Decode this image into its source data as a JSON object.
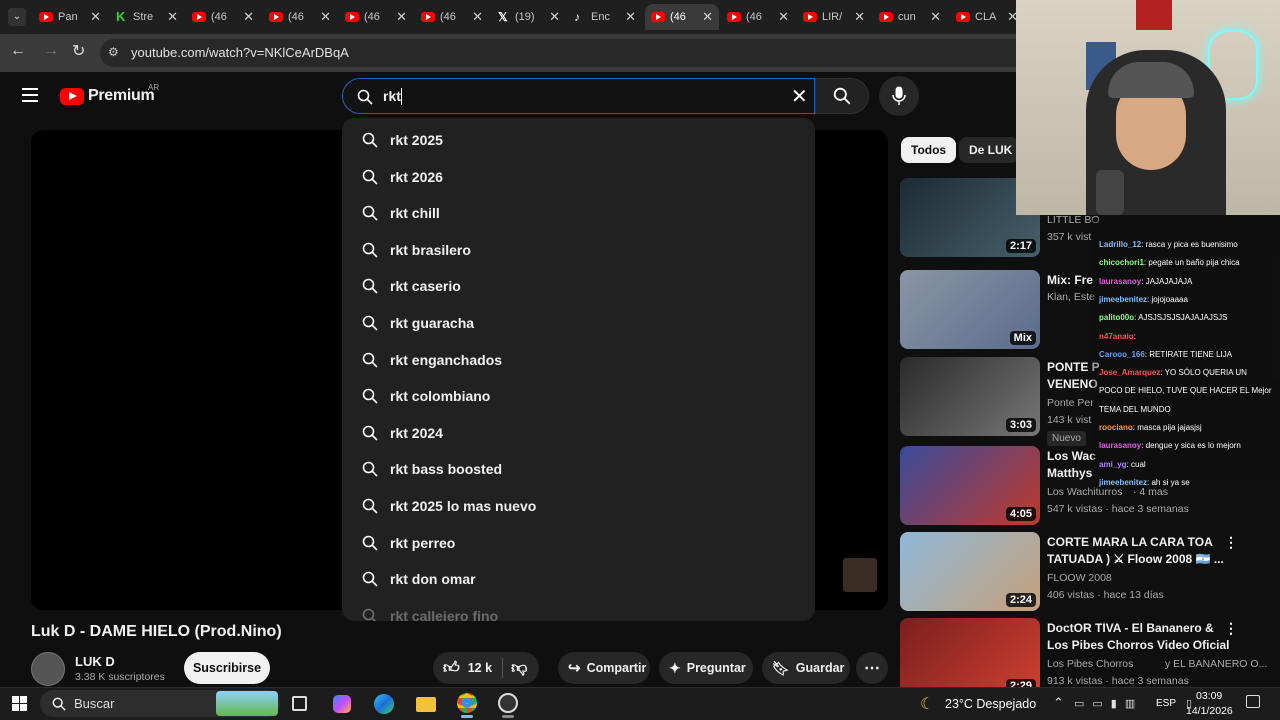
{
  "browser": {
    "tabs": [
      {
        "title": "Pan",
        "favicon": "youtube"
      },
      {
        "title": "Stre",
        "favicon": "kick"
      },
      {
        "title": "(46",
        "favicon": "youtube"
      },
      {
        "title": "(46",
        "favicon": "youtube"
      },
      {
        "title": "(46",
        "favicon": "youtube"
      },
      {
        "title": "(46",
        "favicon": "youtube"
      },
      {
        "title": "(19)",
        "favicon": "x"
      },
      {
        "title": "Enc",
        "favicon": "tiktok"
      },
      {
        "title": "(46",
        "favicon": "youtube",
        "active": true
      },
      {
        "title": "(46",
        "favicon": "youtube"
      },
      {
        "title": "LIR/",
        "favicon": "youtube"
      },
      {
        "title": "cun",
        "favicon": "youtube"
      },
      {
        "title": "CLA",
        "favicon": "youtube"
      }
    ],
    "url": "youtube.com/watch?v=NKlCeArDBqA"
  },
  "header": {
    "logo_text": "Premium",
    "country": "AR",
    "search_value": "rkt"
  },
  "suggestions": [
    "rkt 2025",
    "rkt 2026",
    "rkt chill",
    "rkt brasilero",
    "rkt caserio",
    "rkt guaracha",
    "rkt enganchados",
    "rkt colombiano",
    "rkt 2024",
    "rkt bass boosted",
    "rkt 2025 lo mas nuevo",
    "rkt perreo",
    "rkt don omar",
    "rkt callejero fino"
  ],
  "chips": {
    "all": "Todos",
    "from": "De LUK D"
  },
  "related": [
    {
      "title1": "",
      "title2": "LITTLE BO",
      "meta1": "357 k vist",
      "meta2": "",
      "duration": "2:17"
    },
    {
      "title1": "Mix: Fre",
      "title2": "",
      "meta1": "Klan, Este",
      "meta2": "",
      "duration": "Mix"
    },
    {
      "title1": "PONTE P",
      "title2": "VENENO",
      "meta1": "Ponte Per",
      "meta2": "143 k vist",
      "badge": "Nuevo",
      "duration": "3:03"
    },
    {
      "title1": "Los Wac",
      "title2": "Matthys",
      "meta1": "Los Wachiturros",
      "meta2": "547 k vistas · hace 3 semanas",
      "meta1b": "· 4 mas",
      "duration": "4:05"
    },
    {
      "title1": "CORTE MARA LA CARA TOA",
      "title2": "TATUADA ) ⚔ Floow 2008 🇦🇷 ...",
      "meta1": "FLOOW 2008",
      "meta2": "406 vistas · hace 13 días",
      "duration": "2:24"
    },
    {
      "title1": "DoctOR TIVA - El Bananero &",
      "title2": "Los Pibes Chorros Video Oficial",
      "meta1": "Los Pibes Chorros",
      "meta1b": "y EL BANANERO O...",
      "meta2": "913 k vistas · hace 3 semanas",
      "duration": "2:29"
    }
  ],
  "chat": [
    {
      "user": "Ladrillo_12",
      "text": ": rasca y pica es buenisimo",
      "color": "#7ec0ff"
    },
    {
      "user": "chicochori1",
      "text": ": pegate un baño pija chica",
      "color": "#88ff88"
    },
    {
      "user": "laurasanoy",
      "text": ": JAJAJAJAJA",
      "color": "#e060e0"
    },
    {
      "user": "jimeebenitez",
      "text": ": jojojoaaaa",
      "color": "#7ec0ff"
    },
    {
      "user": "palito00o",
      "text": ": AJSJSJSJSJAJAJAJSJS",
      "color": "#88ff88"
    },
    {
      "user": "n47anaio",
      "text": ":",
      "color": "#ff5050"
    },
    {
      "user": "Carooo_166",
      "text": ": RETIRATE TIENE LIJA",
      "color": "#6aa0ff"
    },
    {
      "user": "Jose_Amarquez",
      "text": ": YO SÓLO QUERIA UN",
      "color": "#ff5050"
    },
    {
      "user": "",
      "text": "POCO DE HIELO, TUVE QUE HACER EL Mejor",
      "color": "#fff"
    },
    {
      "user": "",
      "text": "TEMA DEL MUNDO",
      "color": "#fff"
    },
    {
      "user": "roociano",
      "text": ": masca pija jajasjsj",
      "color": "#ff9a50"
    },
    {
      "user": "laurasanoy",
      "text": ": dengue y sica es lo mejorn",
      "color": "#e060e0"
    },
    {
      "user": "ami_yg",
      "text": ": cual",
      "color": "#b080ff"
    },
    {
      "user": "jimeebenitez",
      "text": ": ah si ya se",
      "color": "#7ec0ff"
    }
  ],
  "video": {
    "title": "Luk D - DAME HIELO (Prod.Nino)",
    "channel": "LUK D",
    "subscribers": "3.38 K suscriptores",
    "subscribe_label": "Suscribirse",
    "likes": "12 k",
    "share_label": "Compartir",
    "ask_label": "Preguntar",
    "save_label": "Guardar"
  },
  "taskbar": {
    "search_placeholder": "Buscar",
    "weather": "23°C Despejado",
    "lang": "ESP",
    "time": "03:09",
    "date": "14/1/2026"
  }
}
